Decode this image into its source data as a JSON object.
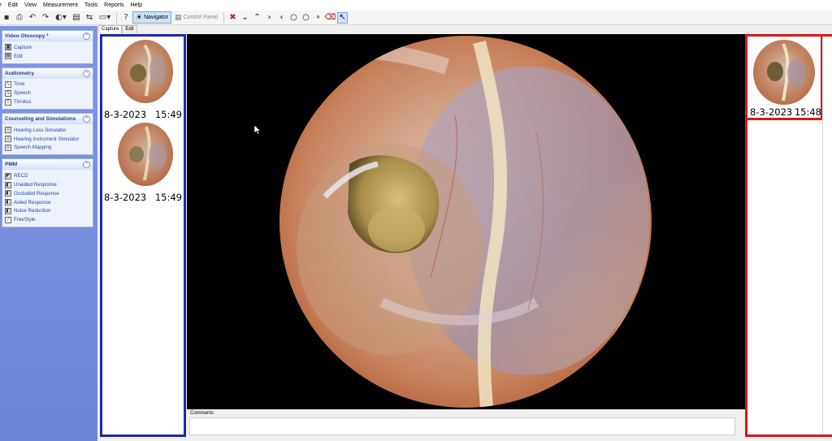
{
  "menu": [
    "e",
    "Edit",
    "View",
    "Measurement",
    "Tools",
    "Reports",
    "Help"
  ],
  "toolbar": {
    "navigator_label": "Navigator",
    "control_panel_label": "Control Panel"
  },
  "taskpane": {
    "groups": [
      {
        "title": "Video Otoscopy *",
        "items": [
          {
            "label": "Capture",
            "icon": "camera-icon"
          },
          {
            "label": "Edit",
            "icon": "edit-icon"
          }
        ]
      },
      {
        "title": "Audiometry",
        "items": [
          {
            "label": "Tone",
            "icon": "tone-icon"
          },
          {
            "label": "Speech",
            "icon": "speech-icon"
          },
          {
            "label": "Tinnitus",
            "icon": "tinnitus-icon"
          }
        ]
      },
      {
        "title": "Counseling and Simulations",
        "items": [
          {
            "label": "Hearing Loss Simulator",
            "icon": "simulator-icon"
          },
          {
            "label": "Hearing Instrument Simulator",
            "icon": "instrument-icon"
          },
          {
            "label": "Speech Mapping",
            "icon": "mapping-icon"
          }
        ]
      },
      {
        "title": "PMM",
        "items": [
          {
            "label": "RECD",
            "icon": "recd-icon"
          },
          {
            "label": "Unaided Response",
            "icon": "unaided-icon"
          },
          {
            "label": "Occluded Response",
            "icon": "occluded-icon"
          },
          {
            "label": "Aided Response",
            "icon": "aided-icon"
          },
          {
            "label": "Noise Reduction",
            "icon": "noise-icon"
          },
          {
            "label": "FreeStyle",
            "icon": "freestyle-icon"
          }
        ]
      }
    ]
  },
  "tabs": [
    "Capture",
    "Edit"
  ],
  "thumbnails_left": [
    {
      "date": "8-3-2023",
      "time": "15:49"
    },
    {
      "date": "8-3-2023",
      "time": "15:49"
    }
  ],
  "thumbnails_right": [
    {
      "date": "8-3-2023",
      "time": "15:48"
    }
  ],
  "comments": {
    "label": "Comments",
    "value": ""
  },
  "colors": {
    "left_highlight": "#1c29a8",
    "right_highlight": "#d5191b",
    "taskpane": "#7088d8"
  }
}
